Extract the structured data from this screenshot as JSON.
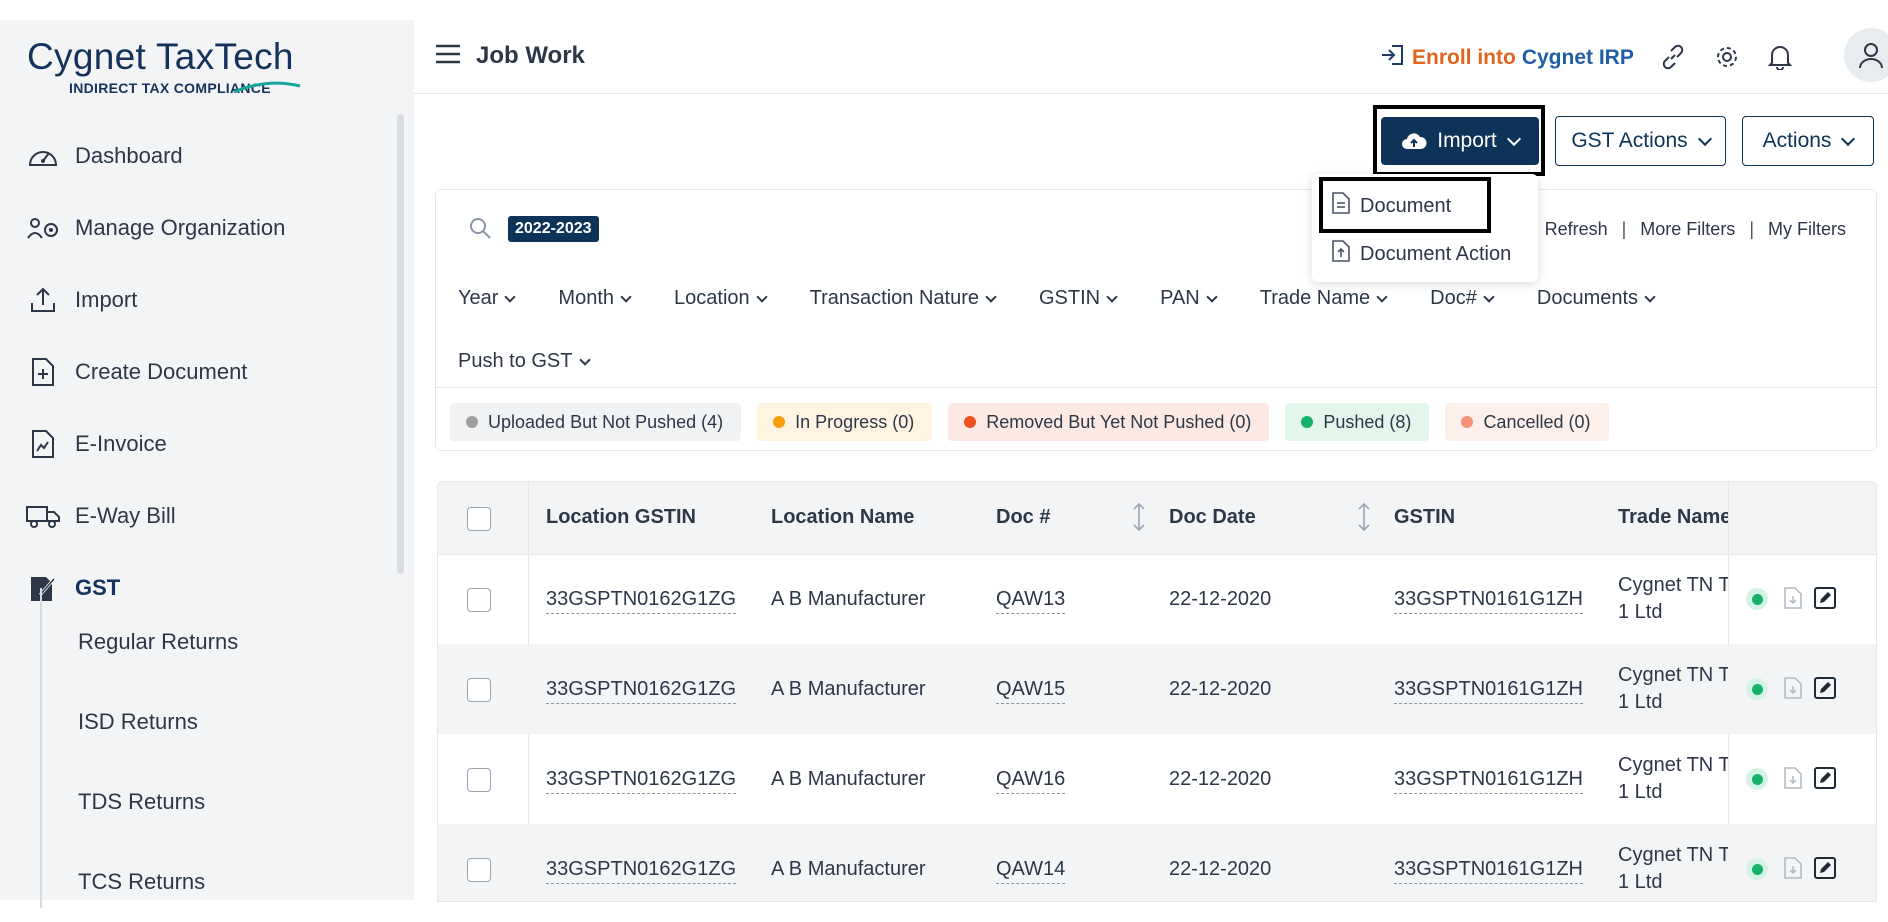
{
  "logo": {
    "brand_a": "Cygnet",
    "brand_b": "TaxTech",
    "tagline": "INDIRECT TAX COMPLIANCE"
  },
  "sidebar": {
    "items": [
      {
        "label": "Dashboard",
        "icon": "speedometer-icon"
      },
      {
        "label": "Manage Organization",
        "icon": "organization-icon"
      },
      {
        "label": "Import",
        "icon": "upload-icon"
      },
      {
        "label": "Create Document",
        "icon": "file-plus-icon"
      },
      {
        "label": "E-Invoice",
        "icon": "invoice-icon"
      },
      {
        "label": "E-Way Bill",
        "icon": "truck-icon"
      },
      {
        "label": "GST",
        "icon": "gst-icon"
      }
    ],
    "sub_items": [
      "Regular Returns",
      "ISD Returns",
      "TDS Returns",
      "TCS Returns"
    ]
  },
  "header": {
    "title": "Job Work",
    "enroll_a": "Enroll into",
    "enroll_b": "Cygnet IRP"
  },
  "actions": {
    "import": "Import",
    "gst_actions": "GST Actions",
    "actions": "Actions"
  },
  "dropdown": {
    "items": [
      "Document",
      "Document Action"
    ]
  },
  "filter": {
    "chip": "2022-2023",
    "links": [
      "Refresh",
      "More Filters",
      "My Filters"
    ],
    "row1": [
      "Year",
      "Month",
      "Location",
      "Transaction Nature",
      "GSTIN",
      "PAN",
      "Trade Name",
      "Doc#",
      "Documents"
    ],
    "row2": [
      "Push to GST"
    ]
  },
  "status": [
    {
      "label": "Uploaded But Not Pushed (4)",
      "color": "#9e9e9e",
      "bg": "#f1f2f4"
    },
    {
      "label": "In Progress (0)",
      "color": "#f59e0b",
      "bg": "#fff4e2"
    },
    {
      "label": "Removed But Yet Not Pushed (0)",
      "color": "#f0501e",
      "bg": "#fde9e3"
    },
    {
      "label": "Pushed (8)",
      "color": "#16b26a",
      "bg": "#e2f6ec"
    },
    {
      "label": "Cancelled (0)",
      "color": "#f4937a",
      "bg": "#fdefea"
    }
  ],
  "table": {
    "headers": [
      "Location GSTIN",
      "Location Name",
      "Doc #",
      "Doc Date",
      "GSTIN",
      "Trade Name"
    ],
    "rows": [
      {
        "loc_gstin": "33GSPTN0162G1ZG",
        "loc_name": "A B Manufacturer",
        "doc": "QAW13",
        "date": "22-12-2020",
        "gstin": "33GSPTN0161G1ZH",
        "trade1": "Cygnet TN Ta",
        "trade2": "1 Ltd"
      },
      {
        "loc_gstin": "33GSPTN0162G1ZG",
        "loc_name": "A B Manufacturer",
        "doc": "QAW15",
        "date": "22-12-2020",
        "gstin": "33GSPTN0161G1ZH",
        "trade1": "Cygnet TN Ta",
        "trade2": "1 Ltd"
      },
      {
        "loc_gstin": "33GSPTN0162G1ZG",
        "loc_name": "A B Manufacturer",
        "doc": "QAW16",
        "date": "22-12-2020",
        "gstin": "33GSPTN0161G1ZH",
        "trade1": "Cygnet TN Ta",
        "trade2": "1 Ltd"
      },
      {
        "loc_gstin": "33GSPTN0162G1ZG",
        "loc_name": "A B Manufacturer",
        "doc": "QAW14",
        "date": "22-12-2020",
        "gstin": "33GSPTN0161G1ZH",
        "trade1": "Cygnet TN Ta",
        "trade2": "1 Ltd"
      }
    ]
  }
}
